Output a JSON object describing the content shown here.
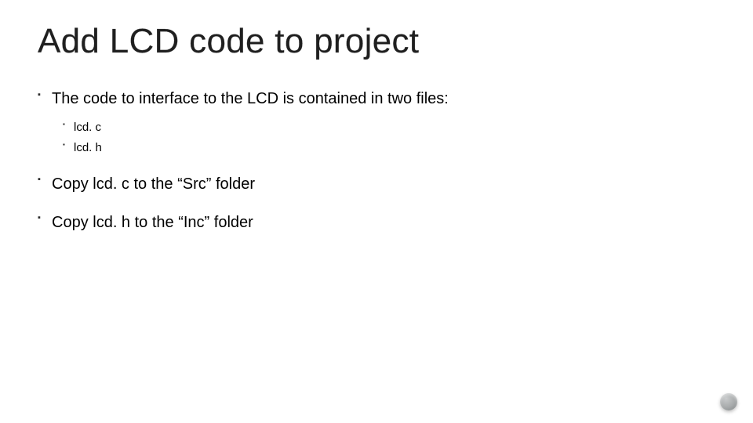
{
  "title": "Add LCD code to project",
  "bullets": {
    "b1": "The code to interface to the LCD is contained in two files:",
    "b1_sub": {
      "s1": "lcd. c",
      "s2": "lcd. h"
    },
    "b2": "Copy lcd. c to the “Src” folder",
    "b3": "Copy lcd. h to the “Inc” folder"
  }
}
